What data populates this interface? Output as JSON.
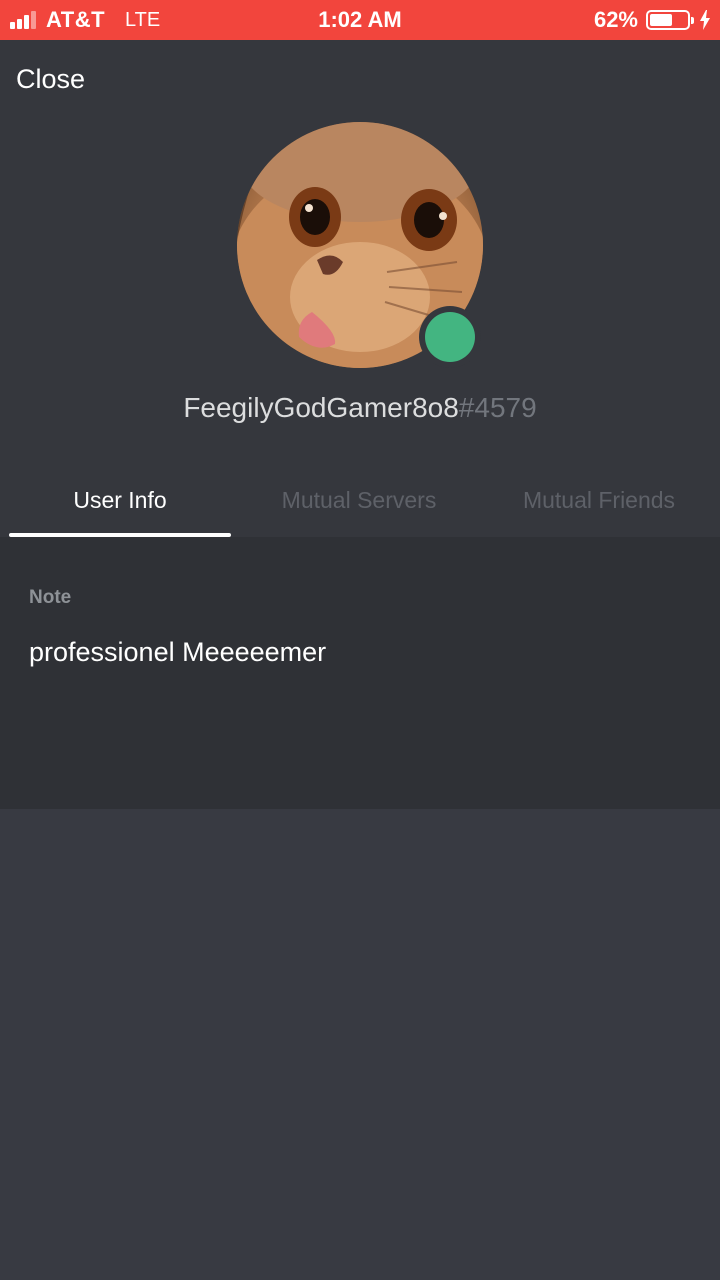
{
  "status_bar": {
    "carrier": "AT&T",
    "network": "LTE",
    "time": "1:02 AM",
    "battery_percent": "62%",
    "battery_level": 0.62,
    "background_color": "#f2453d"
  },
  "header": {
    "close_label": "Close"
  },
  "profile": {
    "avatar_icon": "cat-avatar",
    "online_status": "online",
    "status_color": "#43b581",
    "username": "FeegilyGodGamer8o8",
    "discriminator": "#4579"
  },
  "tabs": [
    {
      "label": "User Info",
      "active": true
    },
    {
      "label": "Mutual Servers",
      "active": false
    },
    {
      "label": "Mutual Friends",
      "active": false
    }
  ],
  "note": {
    "label": "Note",
    "value": "professionel Meeeeemer"
  }
}
